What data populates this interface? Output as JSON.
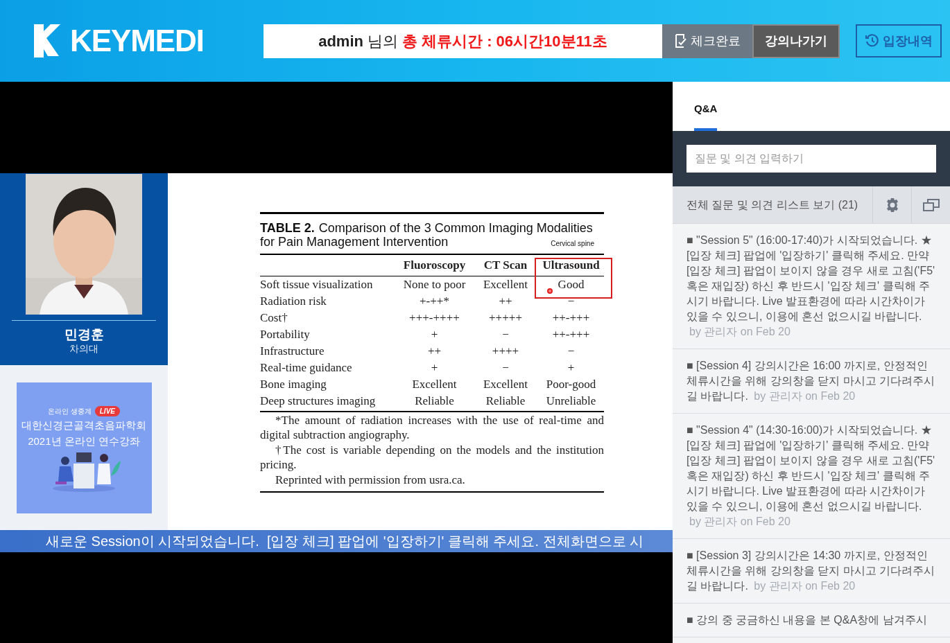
{
  "header": {
    "logo": "KEYMEDI",
    "status": {
      "user": "admin",
      "suffix": "님의",
      "total": "총 체류시간 : 06시간10분11초"
    },
    "buttons": [
      {
        "label": "체크완료",
        "kind": "check"
      },
      {
        "label": "강의나가기",
        "kind": "exit"
      }
    ],
    "history_button": "입장내역"
  },
  "speaker": {
    "name": "민경훈",
    "affiliation": "차의대"
  },
  "banner": {
    "live_label": "온라인 생중계",
    "badge": "LIVE",
    "title_lines": [
      "대한신경근골격초음파학회",
      "2021년 온라인 연수강좌"
    ]
  },
  "slide": {
    "table_label": "TABLE 2.",
    "caption_line1": "Comparison of the 3 Common Imaging Modalities",
    "caption_line2": "for Pain Management Intervention",
    "note": "Cervical spine",
    "columns": [
      {
        "label": "Fluoroscopy",
        "highlighted": false
      },
      {
        "label": "CT Scan",
        "highlighted": false
      },
      {
        "label": "Ultrasound",
        "highlighted": true
      }
    ],
    "rows": [
      {
        "label": "Soft tissue visualization",
        "cells": [
          "None to poor",
          "Excellent",
          "Good"
        ]
      },
      {
        "label": "Radiation risk",
        "cells": [
          "+-++*",
          "++",
          "−"
        ]
      },
      {
        "label": "Cost†",
        "cells": [
          "+++-++++",
          "+++++",
          "++-+++"
        ]
      },
      {
        "label": "Portability",
        "cells": [
          "+",
          "−",
          "++-+++"
        ]
      },
      {
        "label": "Infrastructure",
        "cells": [
          "++",
          "++++",
          "−"
        ]
      },
      {
        "label": "Real-time guidance",
        "cells": [
          "+",
          "−",
          "+"
        ]
      },
      {
        "label": "Bone imaging",
        "cells": [
          "Excellent",
          "Excellent",
          "Poor-good"
        ]
      },
      {
        "label": "Deep structures imaging",
        "cells": [
          "Reliable",
          "Reliable",
          "Unreliable"
        ]
      }
    ],
    "footnotes": [
      "*The amount of radiation increases with the use of real-time and digital subtraction angiography.",
      "†The cost is variable depending on the models and the institution pricing.",
      "Reprinted with permission from usra.ca."
    ]
  },
  "ticker": "새로운 Session이 시작되었습니다.  [입장 체크] 팝업에 '입장하기' 클릭해 주세요. 전체화면으로 시",
  "qa": {
    "tabs": [
      {
        "label": "Q&A",
        "selected": true
      }
    ],
    "placeholder": "질문 및 의견 입력하기",
    "list_header": "전체 질문 및 의견 리스트 보기 (21)",
    "posts": [
      {
        "text": "■ \"Session 5\" (16:00-17:40)가 시작되었습니다. ★[입장 체크] 팝업에 '입장하기' 클릭해 주세요. 만약 [입장 체크] 팝업이 보이지 않을 경우 새로 고침('F5' 혹은 재입장) 하신 후 반드시 '입장 체크' 클릭해 주시기 바랍니다. Live 발표환경에 따라 시간차이가 있을 수 있으니, 이용에 혼선 없으시길 바랍니다.",
        "meta": "by 관리자 on Feb 20"
      },
      {
        "text": "■ [Session 4] 강의시간은 16:00 까지로, 안정적인 체류시간을 위해 강의창을 닫지 마시고 기다려주시길 바랍니다.",
        "meta": "by 관리자 on Feb 20"
      },
      {
        "text": "■ \"Session 4\" (14:30-16:00)가 시작되었습니다. ★[입장 체크] 팝업에 '입장하기' 클릭해 주세요. 만약 [입장 체크] 팝업이 보이지 않을 경우 새로 고침('F5' 혹은 재입장) 하신 후 반드시 '입장 체크' 클릭해 주시기 바랍니다. Live 발표환경에 따라 시간차이가 있을 수 있으니, 이용에 혼선 없으시길 바랍니다.",
        "meta": "by 관리자 on Feb 20"
      },
      {
        "text": "■ [Session 3] 강의시간은 14:30 까지로, 안정적인 체류시간을 위해 강의창을 닫지 마시고 기다려주시길 바랍니다.",
        "meta": "by 관리자 on Feb 20"
      },
      {
        "text": "■ 강의 중 궁금하신 내용을 본 Q&A창에 남겨주시"
      }
    ]
  }
}
